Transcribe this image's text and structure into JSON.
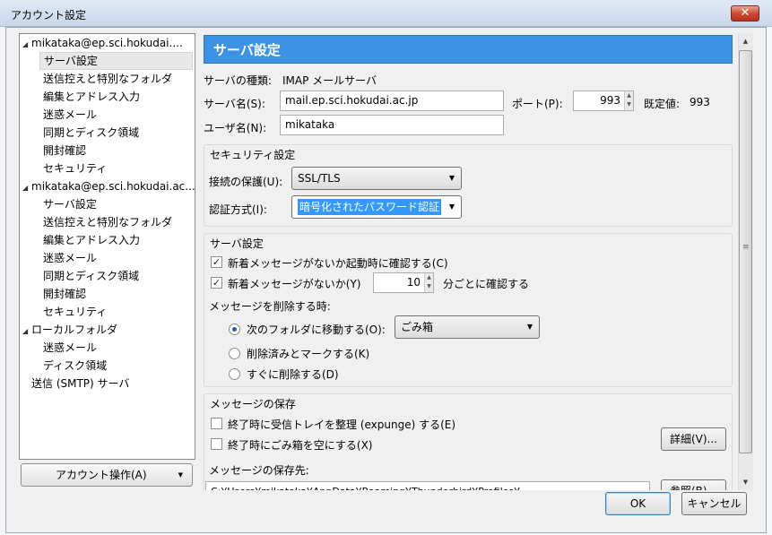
{
  "window": {
    "title": "アカウント設定",
    "close_glyph": "✕"
  },
  "tree": {
    "accounts": [
      {
        "name": "mikataka@ep.sci.hokudai....",
        "items": [
          "サーバ設定",
          "送信控えと特別なフォルダ",
          "編集とアドレス入力",
          "迷惑メール",
          "同期とディスク領域",
          "開封確認",
          "セキュリティ"
        ]
      },
      {
        "name": "mikataka@ep.sci.hokudai.ac...",
        "items": [
          "サーバ設定",
          "送信控えと特別なフォルダ",
          "編集とアドレス入力",
          "迷惑メール",
          "同期とディスク領域",
          "開封確認",
          "セキュリティ"
        ]
      },
      {
        "name": "ローカルフォルダ",
        "items": [
          "迷惑メール",
          "ディスク領域"
        ]
      }
    ],
    "smtp": "送信 (SMTP) サーバ",
    "selected": "サーバ設定"
  },
  "account_actions": "アカウント操作(A)",
  "panel": {
    "header": "サーバ設定",
    "server_type_label": "サーバの種類:",
    "server_type_value": "IMAP メールサーバ",
    "server_name_label": "サーバ名(S):",
    "server_name_value": "mail.ep.sci.hokudai.ac.jp",
    "port_label": "ポート(P):",
    "port_value": "993",
    "default_label": "既定値:",
    "default_value": "993",
    "username_label": "ユーザ名(N):",
    "username_value": "mikataka",
    "security": {
      "title": "セキュリティ設定",
      "conn_label": "接続の保護(U):",
      "conn_value": "SSL/TLS",
      "auth_label": "認証方式(I):",
      "auth_value": "暗号化されたパスワード認証"
    },
    "server_settings": {
      "title": "サーバ設定",
      "check_startup": "新着メッセージがないか起動時に確認する(C)",
      "check_every": "新着メッセージがないか(Y)",
      "check_minutes": "10",
      "check_every_suffix": "分ごとに確認する",
      "on_delete_label": "メッセージを削除する時:",
      "move_to_folder": "次のフォルダに移動する(O):",
      "folder_value": "ごみ箱",
      "mark_deleted": "削除済みとマークする(K)",
      "delete_now": "すぐに削除する(D)"
    },
    "storage": {
      "title": "メッセージの保存",
      "expunge": "終了時に受信トレイを整理 (expunge) する(E)",
      "empty_trash": "終了時にごみ箱を空にする(X)",
      "details_btn": "詳細(V)...",
      "store_path_label": "メッセージの保存先:",
      "store_path_value": "C:¥Users¥mikataka¥AppData¥Roaming¥Thunderbird¥Profiles¥...",
      "browse_btn": "参照(B)..."
    }
  },
  "buttons": {
    "ok": "OK",
    "cancel": "キャンセル"
  }
}
